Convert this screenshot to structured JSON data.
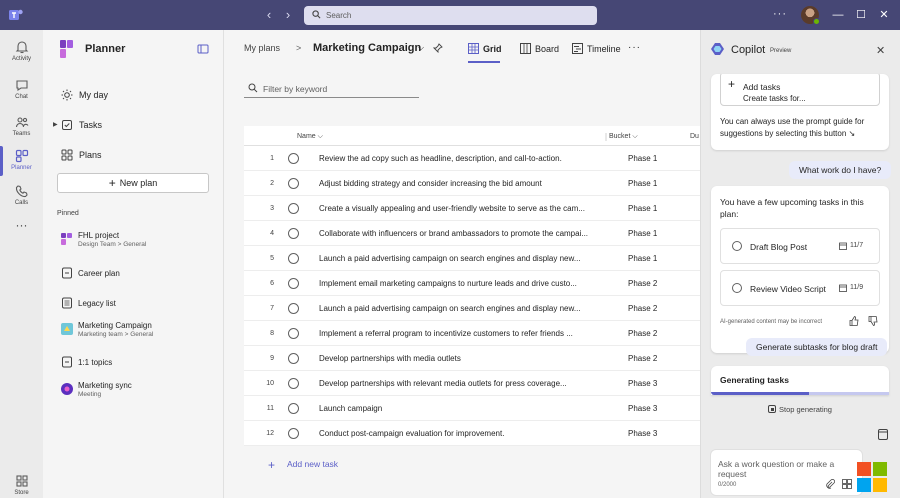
{
  "titlebar": {
    "search_placeholder": "Search",
    "more": "···",
    "presence_color": "#6bb700",
    "window_controls": [
      "minimize-icon",
      "maximize-icon",
      "close-icon"
    ]
  },
  "rail": {
    "items": [
      {
        "label": "Activity",
        "icon": "bell-icon"
      },
      {
        "label": "Chat",
        "icon": "chat-icon"
      },
      {
        "label": "Teams",
        "icon": "teams-icon"
      },
      {
        "label": "Planner",
        "icon": "planner-icon",
        "active": true
      },
      {
        "label": "Calls",
        "icon": "phone-icon"
      },
      {
        "label": "···",
        "icon": "more-icon"
      },
      {
        "label": "Store",
        "icon": "store-icon"
      }
    ]
  },
  "left": {
    "title": "Planner",
    "nav": [
      {
        "label": "My day",
        "icon": "sun-icon"
      },
      {
        "label": "Tasks",
        "icon": "tasks-icon"
      },
      {
        "label": "Plans",
        "icon": "plans-icon"
      }
    ],
    "new_plan": "New plan",
    "pinned_heading": "Pinned",
    "pinned": [
      {
        "title": "FHL project",
        "subtitle": "Design Team > General"
      },
      {
        "title": "Career plan",
        "subtitle": ""
      },
      {
        "title": "Legacy list",
        "subtitle": ""
      },
      {
        "title": "Marketing Campaign",
        "subtitle": "Marketing team > General"
      },
      {
        "title": "1:1 topics",
        "subtitle": ""
      },
      {
        "title": "Marketing sync",
        "subtitle": "Meeting"
      }
    ]
  },
  "main": {
    "breadcrumb": "My plans",
    "breadcrumb_sep": ">",
    "plan_title": "Marketing Campaign",
    "tabs": [
      {
        "label": "Grid",
        "active": true
      },
      {
        "label": "Board"
      },
      {
        "label": "Timeline"
      }
    ],
    "tabs_more": "···",
    "filter_placeholder": "Filter by keyword",
    "columns": {
      "name": "Name",
      "bucket": "Bucket",
      "due": "Du"
    },
    "rows": [
      {
        "n": "1",
        "name": "Review the ad copy such as headline, description, and call-to-action.",
        "bucket": "Phase 1"
      },
      {
        "n": "2",
        "name": "Adjust bidding strategy and consider increasing the bid amount",
        "bucket": "Phase 1"
      },
      {
        "n": "3",
        "name": "Create a visually appealing and user-friendly website to serve as the cam...",
        "bucket": "Phase 1"
      },
      {
        "n": "4",
        "name": "Collaborate with influencers or brand ambassadors to promote the campai...",
        "bucket": "Phase 1"
      },
      {
        "n": "5",
        "name": "Launch a paid advertising campaign on search engines and display new...",
        "bucket": "Phase 1"
      },
      {
        "n": "6",
        "name": "Implement email marketing campaigns to nurture leads and drive custo...",
        "bucket": "Phase 2"
      },
      {
        "n": "7",
        "name": "Launch a paid advertising campaign on search engines and display new...",
        "bucket": "Phase 2"
      },
      {
        "n": "8",
        "name": "Implement a referral program to incentivize customers to refer friends ...",
        "bucket": "Phase 2"
      },
      {
        "n": "9",
        "name": "Develop partnerships with media outlets",
        "bucket": "Phase 2"
      },
      {
        "n": "10",
        "name": "Develop partnerships with relevant media outlets for press coverage...",
        "bucket": "Phase 3"
      },
      {
        "n": "11",
        "name": "Launch campaign",
        "bucket": "Phase 3"
      },
      {
        "n": "12",
        "name": "Conduct post-campaign evaluation for improvement.",
        "bucket": "Phase 3"
      }
    ],
    "add_task": "Add new task"
  },
  "copilot": {
    "title": "Copilot",
    "badge": "Preview",
    "add_tasks_title": "Add tasks",
    "add_tasks_sub": "Create tasks for...",
    "guide_text": "You can always use the prompt guide for suggestions by selecting this button",
    "user_msg_1": "What work do I have?",
    "response_text": "You have a few upcoming tasks in this plan:",
    "tasks": [
      {
        "title": "Draft Blog Post",
        "date": "11/7"
      },
      {
        "title": "Review Video Script",
        "date": "11/9"
      }
    ],
    "disclaimer": "AI-generated content may be incorrect",
    "user_msg_2": "Generate subtasks for blog draft",
    "generating": "Generating tasks",
    "generating_progress": 0.55,
    "stop": "Stop generating",
    "compose_placeholder": "Ask a work question or make a request",
    "char_count": "0/2000"
  },
  "colors": {
    "titlebar": "#464775",
    "accent": "#5b5fc7",
    "user_bubble": "#e8ebfa"
  }
}
